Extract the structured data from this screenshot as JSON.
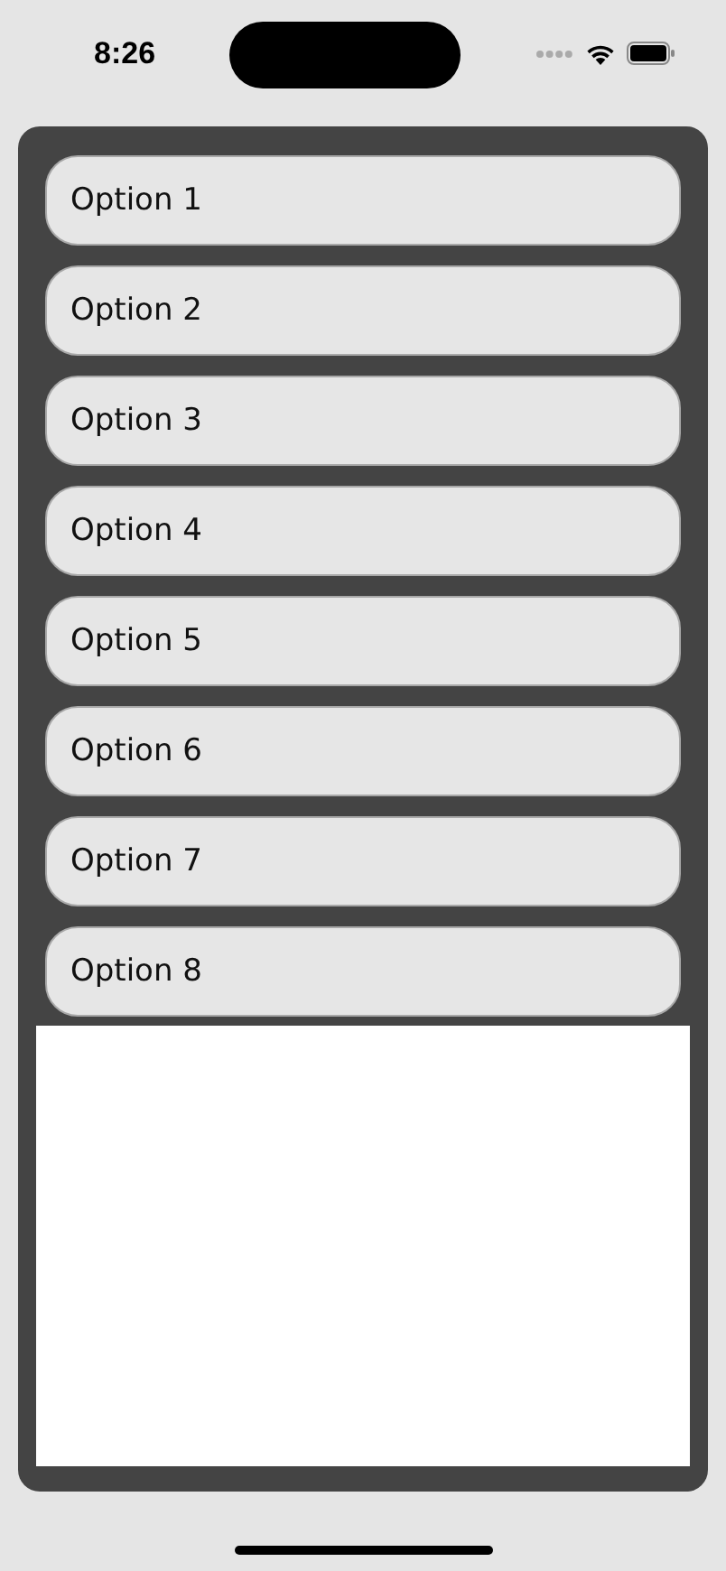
{
  "status_bar": {
    "time": "8:26"
  },
  "options": [
    {
      "label": "Option 1"
    },
    {
      "label": "Option 2"
    },
    {
      "label": "Option 3"
    },
    {
      "label": "Option 4"
    },
    {
      "label": "Option 5"
    },
    {
      "label": "Option 6"
    },
    {
      "label": "Option 7"
    },
    {
      "label": "Option 8"
    }
  ]
}
